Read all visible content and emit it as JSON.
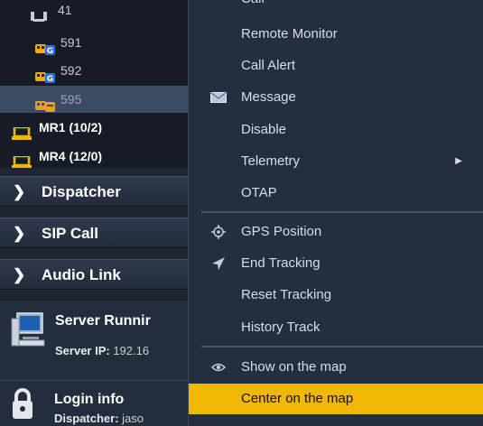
{
  "tree": {
    "rows": [
      {
        "label": "41",
        "icon": "radio-icon"
      },
      {
        "label": "591",
        "icon": "gps-terminal-icon"
      },
      {
        "label": "592",
        "icon": "gps-terminal-icon"
      },
      {
        "label": "595",
        "icon": "gps-terminal-icon"
      },
      {
        "label": "MR1 (10/2)",
        "icon": "monitor-group-icon"
      },
      {
        "label": "MR4 (12/0)",
        "icon": "monitor-group-icon"
      }
    ]
  },
  "sections": {
    "dispatcher": "Dispatcher",
    "sip_call": "SIP Call",
    "audio_link": "Audio Link"
  },
  "server": {
    "title": "Server Runnir",
    "ip_label": "Server IP:",
    "ip_value": "192.16"
  },
  "login": {
    "title": "Login info",
    "dispatcher_label": "Dispatcher:",
    "dispatcher_value": "jaso"
  },
  "menu": {
    "call": "Call",
    "remote_monitor": "Remote Monitor",
    "call_alert": "Call Alert",
    "message": "Message",
    "disable": "Disable",
    "telemetry": "Telemetry",
    "otap": "OTAP",
    "gps_position": "GPS Position",
    "end_tracking": "End Tracking",
    "reset_tracking": "Reset Tracking",
    "history_track": "History Track",
    "show_on_map": "Show on the map",
    "center_on_map": "Center on the map"
  },
  "colors": {
    "highlight": "#f2b705",
    "terminal_orange": "#f5a800",
    "terminal_blue": "#2f6fd0"
  }
}
